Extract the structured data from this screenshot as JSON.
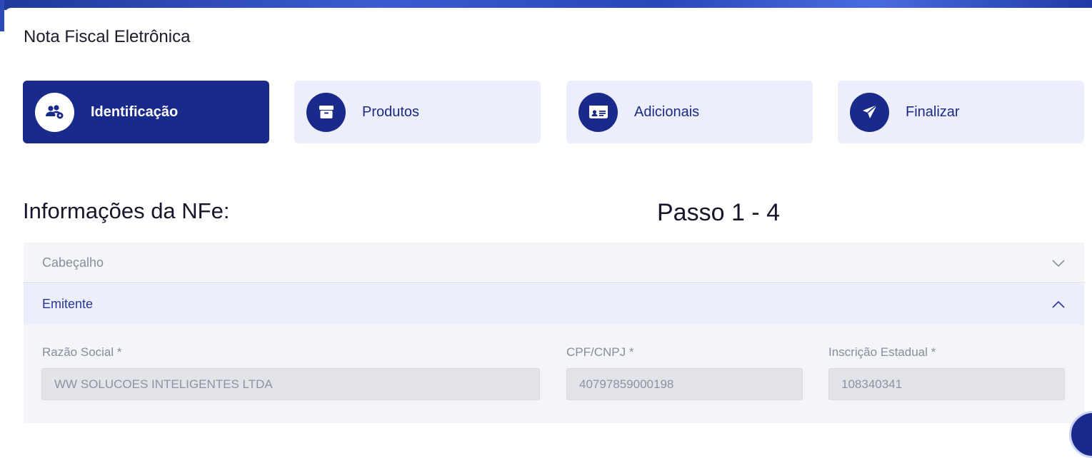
{
  "app": {
    "title": "Nota Fiscal Eletrônica"
  },
  "steps": [
    {
      "label": "Identificação",
      "icon": "users-gear-icon",
      "active": true
    },
    {
      "label": "Produtos",
      "icon": "box-icon",
      "active": false
    },
    {
      "label": "Adicionais",
      "icon": "id-card-icon",
      "active": false
    },
    {
      "label": "Finalizar",
      "icon": "paper-plane-icon",
      "active": false
    }
  ],
  "section": {
    "title": "Informações da NFe:",
    "step_counter": "Passo 1 - 4"
  },
  "accordion": {
    "items": [
      {
        "label": "Cabeçalho",
        "expanded": false
      },
      {
        "label": "Emitente",
        "expanded": true
      }
    ]
  },
  "emitente": {
    "fields": [
      {
        "label": "Razão Social *",
        "value": "WW SOLUCOES INTELIGENTES LTDA"
      },
      {
        "label": "CPF/CNPJ *",
        "value": "40797859000198"
      },
      {
        "label": "Inscrição Estadual *",
        "value": "108340341"
      }
    ]
  },
  "colors": {
    "primary": "#1a2a8b",
    "step_bg": "#eceefb",
    "panel_bg": "#f4f5f9"
  }
}
